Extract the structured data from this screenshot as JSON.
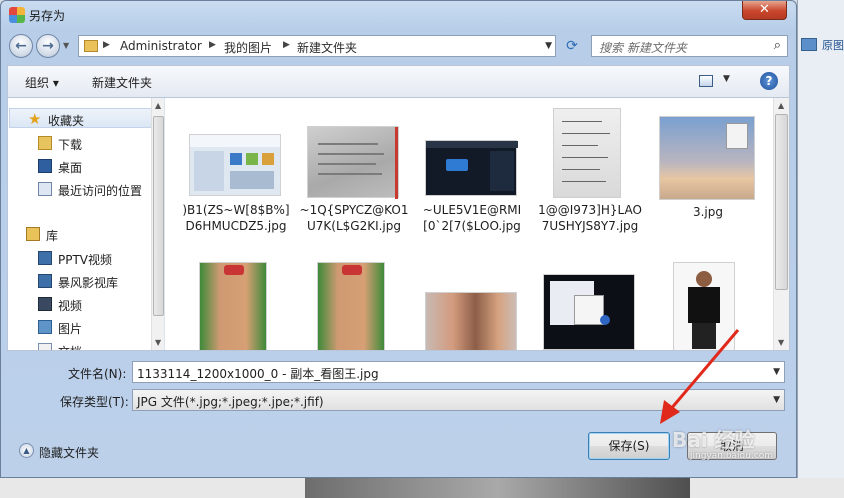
{
  "window": {
    "title": "另存为"
  },
  "background": {
    "right_label": "原图"
  },
  "nav": {
    "breadcrumbs": [
      "Administrator",
      "我的图片",
      "新建文件夹"
    ],
    "search_placeholder": "搜索 新建文件夹"
  },
  "toolbar": {
    "organize": "组织 ▾",
    "new_folder": "新建文件夹"
  },
  "sidebar": {
    "items": [
      {
        "label": "收藏夹",
        "icon": "star-icon"
      },
      {
        "label": "下载",
        "icon": "download-folder-icon"
      },
      {
        "label": "桌面",
        "icon": "desktop-icon"
      },
      {
        "label": "最近访问的位置",
        "icon": "recent-places-icon"
      },
      {
        "label": "库",
        "icon": "library-icon"
      },
      {
        "label": "PPTV视频",
        "icon": "video-library-icon"
      },
      {
        "label": "暴风影视库",
        "icon": "video-library-icon"
      },
      {
        "label": "视频",
        "icon": "video-library-icon"
      },
      {
        "label": "图片",
        "icon": "pictures-library-icon"
      },
      {
        "label": "文档",
        "icon": "documents-library-icon"
      }
    ]
  },
  "files": [
    {
      "name": ")B1(ZS~W[8$B%]D6HMUCDZ5.jpg",
      "kind": "screenshot"
    },
    {
      "name": "~1Q{SPYCZ@KO1U7K(L$G2KI.jpg",
      "kind": "paper"
    },
    {
      "name": "~ULE5V1E@RMI[0`2[7($LOO.jpg",
      "kind": "dark-app"
    },
    {
      "name": "1@@I973]H}LAO7USHYJS8Y7.jpg",
      "kind": "notes"
    },
    {
      "name": "3.jpg",
      "kind": "sky"
    },
    {
      "name": "",
      "kind": "athlete-green"
    },
    {
      "name": "",
      "kind": "athlete-green"
    },
    {
      "name": "",
      "kind": "fighters"
    },
    {
      "name": "",
      "kind": "dark-menu"
    },
    {
      "name": "",
      "kind": "athlete-white"
    }
  ],
  "form": {
    "filename_label": "文件名(N):",
    "filename_value": "1133114_1200x1000_0 - 副本_看图王.jpg",
    "type_label": "保存类型(T):",
    "type_value": "JPG 文件(*.jpg;*.jpeg;*.jpe;*.jfif)"
  },
  "footer": {
    "hide_folders": "隐藏文件夹",
    "save": "保存(S)",
    "cancel": "取消"
  },
  "watermark": {
    "text": "Bai 经验",
    "sub": "jingyan.baidu.com"
  },
  "colors": {
    "annotation_arrow": "#e0281b",
    "title_gradient": "#c9dcf0",
    "close_button": "#c9462c"
  }
}
